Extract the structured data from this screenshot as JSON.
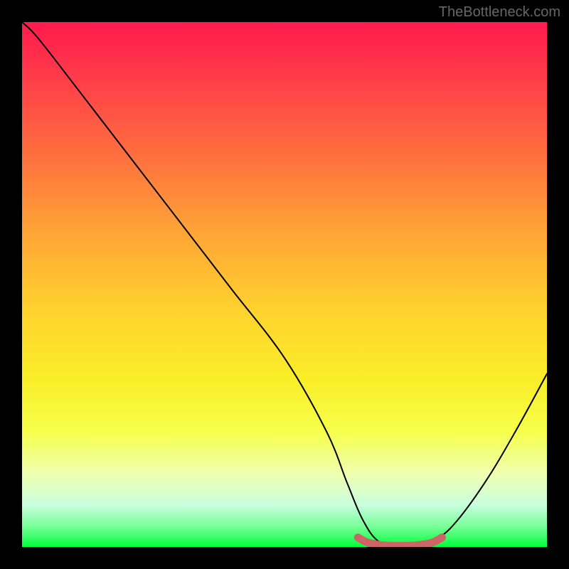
{
  "watermark": "TheBottleneck.com",
  "chart_data": {
    "type": "line",
    "title": "",
    "xlabel": "",
    "ylabel": "",
    "xlim": [
      0,
      100
    ],
    "ylim": [
      0,
      100
    ],
    "series": [
      {
        "name": "bottleneck-curve",
        "x": [
          0,
          3,
          10,
          20,
          30,
          40,
          50,
          58,
          62,
          65,
          68,
          72,
          75,
          78,
          82,
          88,
          94,
          100
        ],
        "values": [
          100,
          97,
          88,
          75,
          62,
          49,
          36,
          22,
          12,
          5,
          1,
          0,
          0,
          1,
          4,
          12,
          22,
          33
        ]
      },
      {
        "name": "sweet-spot-highlight",
        "x": [
          64,
          66,
          69,
          72,
          75,
          78,
          80
        ],
        "values": [
          1.8,
          0.8,
          0.3,
          0.2,
          0.3,
          0.8,
          1.8
        ]
      }
    ],
    "gradient_stops": [
      {
        "pos": 0,
        "color": "#ff1a4d"
      },
      {
        "pos": 25,
        "color": "#ff6e3f"
      },
      {
        "pos": 55,
        "color": "#ffd22e"
      },
      {
        "pos": 78,
        "color": "#f6ff4a"
      },
      {
        "pos": 96,
        "color": "#7aff9a"
      },
      {
        "pos": 100,
        "color": "#00ff3a"
      }
    ]
  }
}
